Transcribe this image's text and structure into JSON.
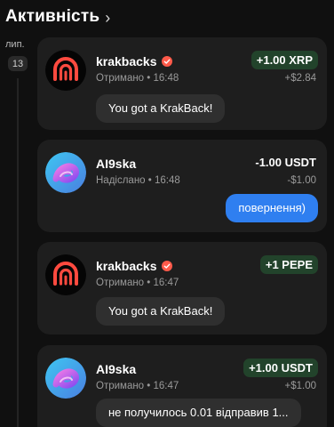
{
  "header": {
    "title": "Активність",
    "chevron_icon": "chevron-right-icon"
  },
  "date_group": {
    "month": "лип.",
    "day": "13"
  },
  "colors": {
    "background": "#101010",
    "card": "#1e1e1e",
    "positive_badge": "#22432b",
    "return_button": "#2f7ff0",
    "verified_badge": "#ff5a4a"
  },
  "transactions": [
    {
      "sender": "krakbacks",
      "verified": true,
      "status": "Отримано",
      "time": "16:48",
      "amount": "+1.00 XRP",
      "fiat": "+$2.84",
      "comment": "You got a KrakBack!"
    },
    {
      "sender": "AI9ska",
      "verified": false,
      "status": "Надіслано",
      "time": "16:48",
      "amount": "-1.00 USDT",
      "fiat": "-$1.00",
      "action": "повернення)"
    },
    {
      "sender": "krakbacks",
      "verified": true,
      "status": "Отримано",
      "time": "16:47",
      "amount": "+1 PEPE",
      "comment": "You got a KrakBack!"
    },
    {
      "sender": "AI9ska",
      "verified": false,
      "status": "Отримано",
      "time": "16:47",
      "amount": "+1.00 USDT",
      "fiat": "+$1.00",
      "comment": "не получилось 0.01 відправив 1..."
    }
  ]
}
